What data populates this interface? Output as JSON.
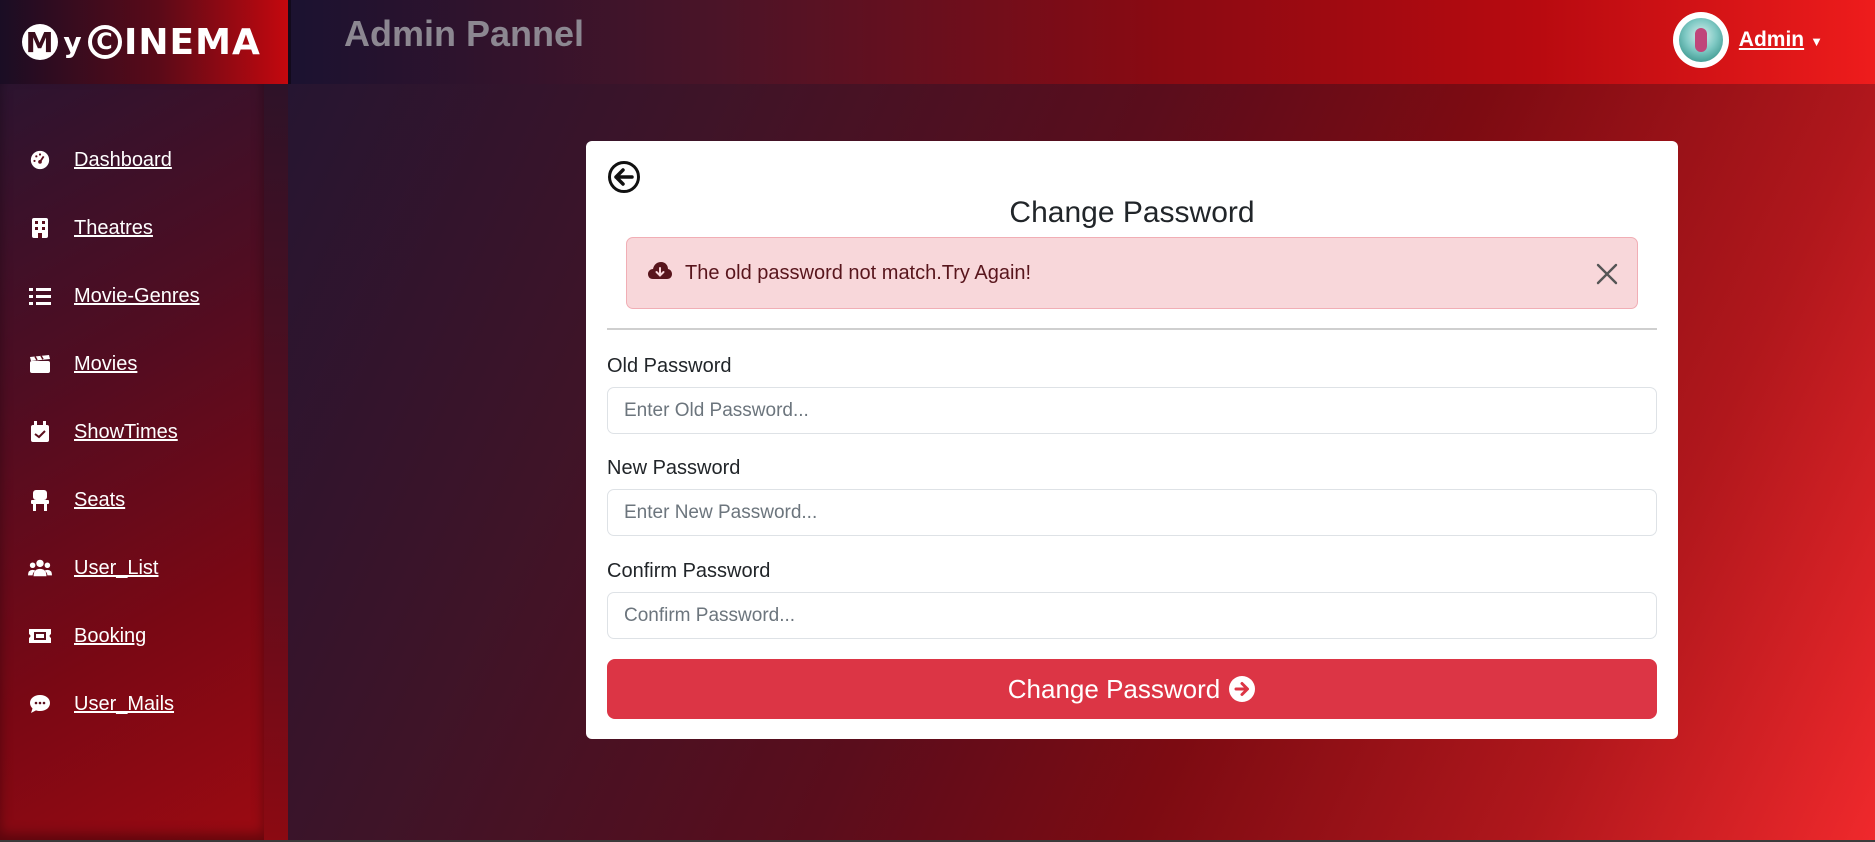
{
  "header": {
    "logo_prefix": "My",
    "logo_suffix": "INEMA",
    "title": "Admin Pannel",
    "user_name": "Admin"
  },
  "sidebar": {
    "items": [
      {
        "label": "Dashboard",
        "icon": "dashboard-gauge-icon"
      },
      {
        "label": "Theatres",
        "icon": "building-icon"
      },
      {
        "label": "Movie-Genres",
        "icon": "list-icon"
      },
      {
        "label": "Movies",
        "icon": "clapperboard-icon"
      },
      {
        "label": "ShowTimes",
        "icon": "calendar-check-icon"
      },
      {
        "label": "Seats",
        "icon": "chair-icon"
      },
      {
        "label": "User_List",
        "icon": "users-icon"
      },
      {
        "label": "Booking",
        "icon": "ticket-icon"
      },
      {
        "label": "User_Mails",
        "icon": "comment-icon"
      }
    ]
  },
  "form": {
    "title": "Change Password",
    "alert_text": "The old password not match.Try Again!",
    "fields": [
      {
        "label": "Old Password",
        "placeholder": "Enter Old Password..."
      },
      {
        "label": "New Password",
        "placeholder": "Enter New Password..."
      },
      {
        "label": "Confirm Password",
        "placeholder": "Confirm Password..."
      }
    ],
    "submit_label": "Change Password"
  },
  "colors": {
    "accent": "#dc3545",
    "alert_bg": "#f8d7da",
    "alert_text": "#58151c"
  }
}
